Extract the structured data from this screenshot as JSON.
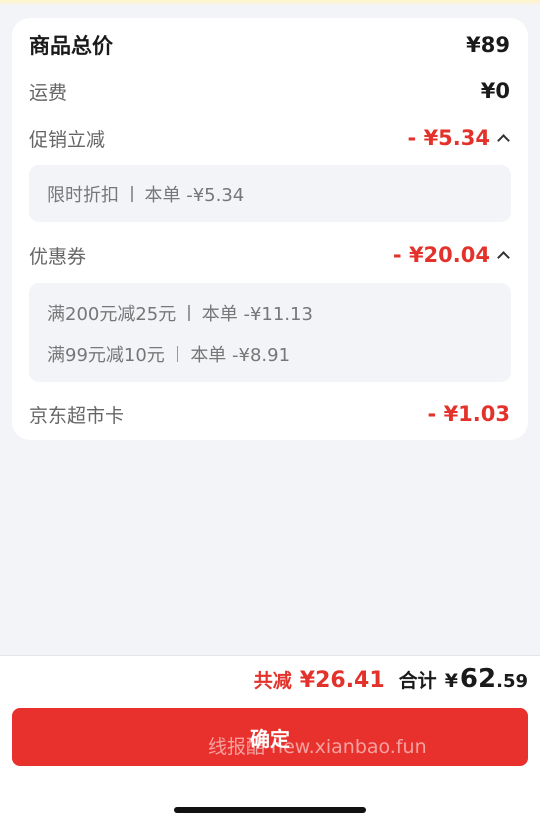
{
  "summary_card": {
    "goods_total": {
      "label": "商品总价",
      "value": "¥89"
    },
    "shipping": {
      "label": "运费",
      "value": "¥0"
    },
    "promotion": {
      "label": "促销立减",
      "value": "- ¥5.34",
      "details": [
        {
          "name": "限时折扣",
          "amount": "本单 -¥5.34"
        }
      ]
    },
    "coupon": {
      "label": "优惠券",
      "value": "- ¥20.04",
      "details": [
        {
          "name": "满200元减25元",
          "amount": "本单 -¥11.13"
        },
        {
          "name": "满99元减10元",
          "amount": "本单 -¥8.91"
        }
      ]
    },
    "supermarket_card": {
      "label": "京东超市卡",
      "value": "- ¥1.03"
    }
  },
  "footer": {
    "discount_label": "共减",
    "discount_value": "¥26.41",
    "total_label": "合计",
    "total_currency": "¥",
    "total_int": "62",
    "total_dec": ".59",
    "confirm_label": "确定",
    "watermark": "线报酷 new.xianbao.fun"
  },
  "colors": {
    "accent": "#e3322b",
    "button": "#e8302c",
    "background": "#f3f4f8"
  }
}
